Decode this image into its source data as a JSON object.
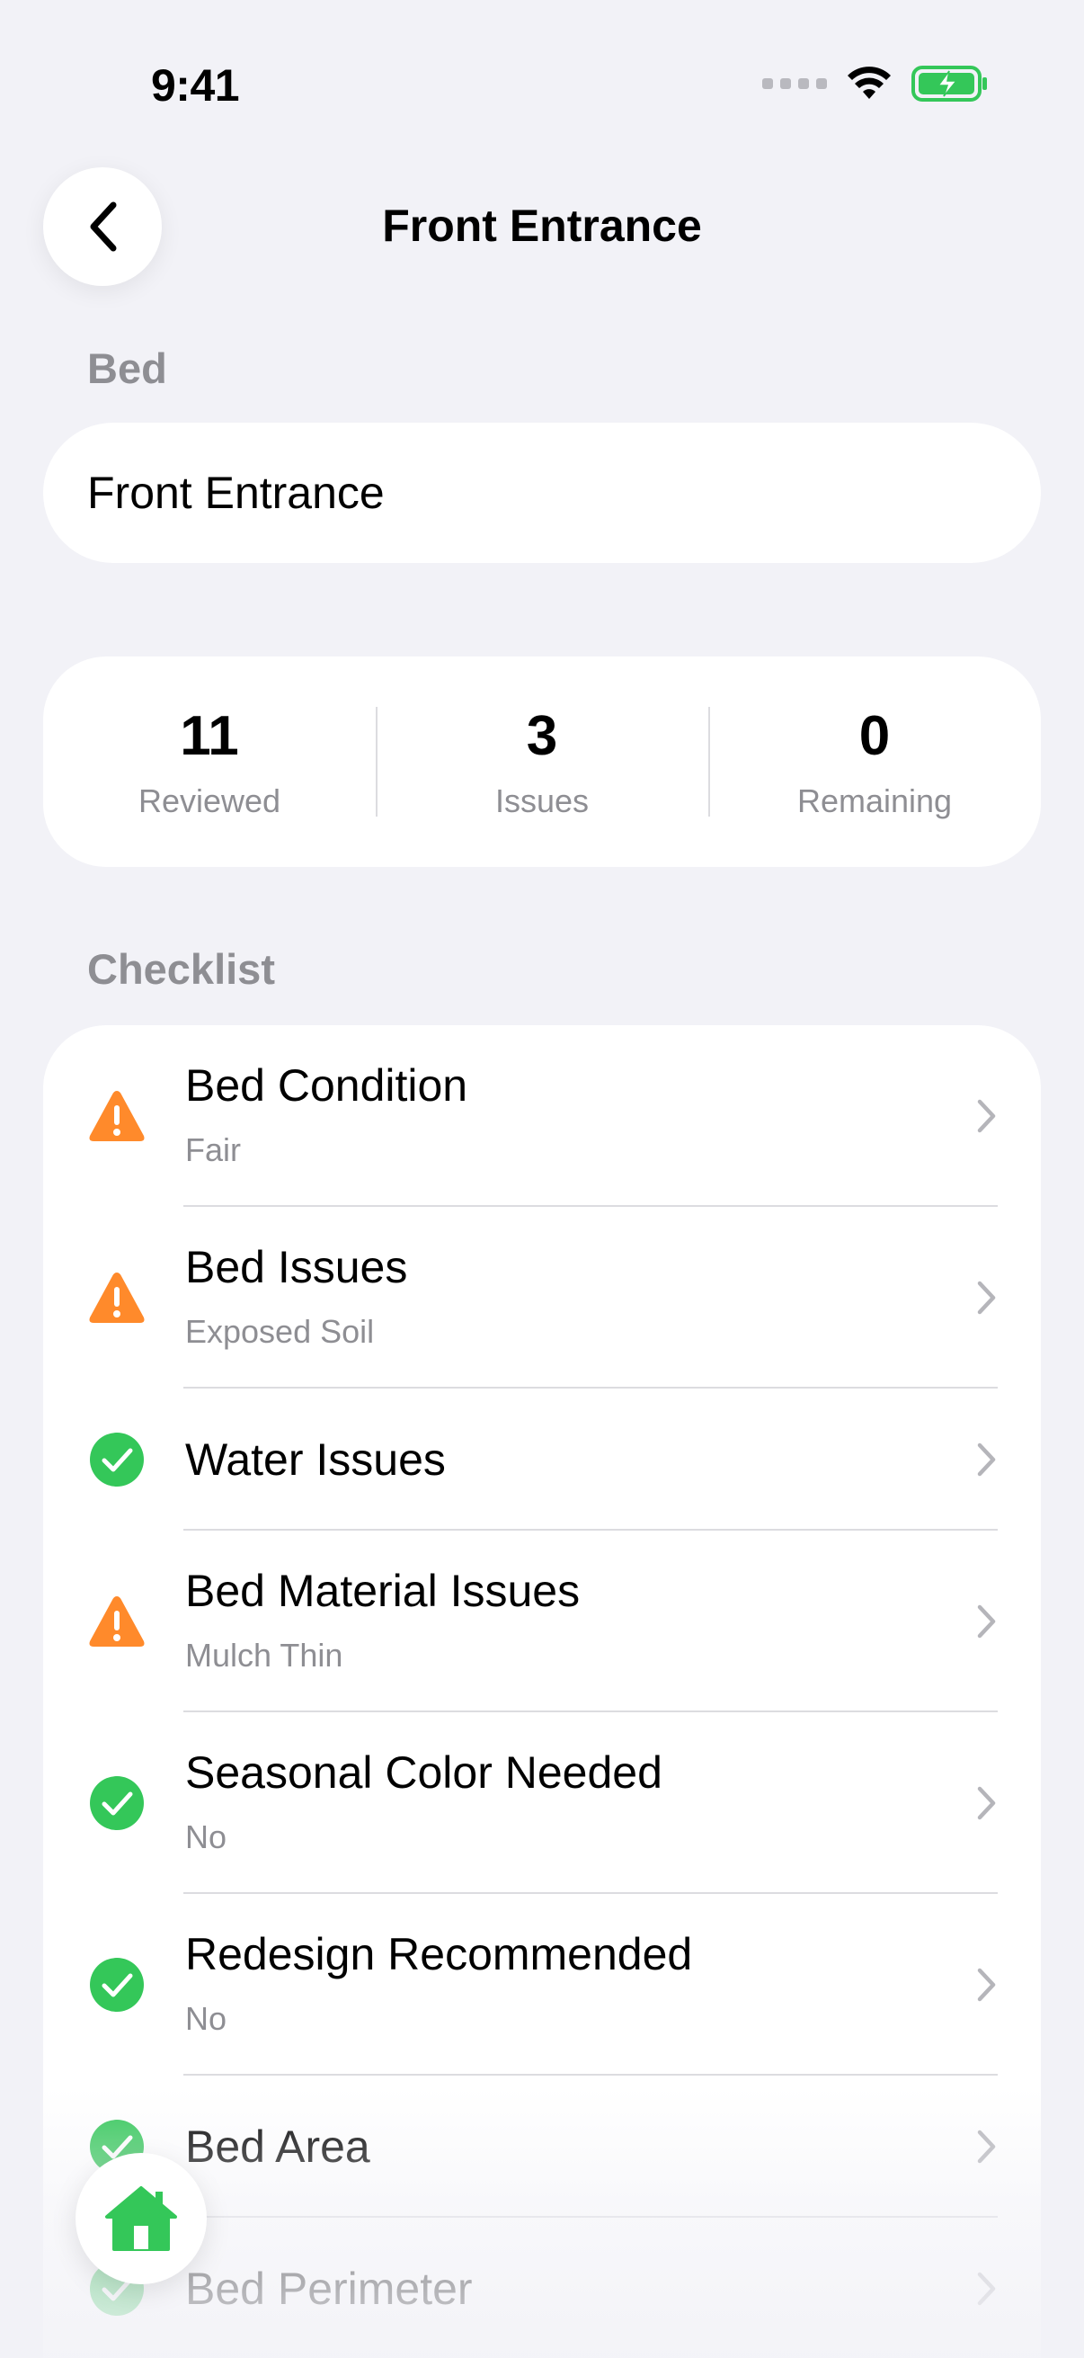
{
  "status_bar": {
    "time": "9:41"
  },
  "nav": {
    "title": "Front Entrance"
  },
  "bed": {
    "section_label": "Bed",
    "value": "Front Entrance"
  },
  "stats": [
    {
      "value": "11",
      "label": "Reviewed"
    },
    {
      "value": "3",
      "label": "Issues"
    },
    {
      "value": "0",
      "label": "Remaining"
    }
  ],
  "checklist": {
    "section_label": "Checklist",
    "items": [
      {
        "title": "Bed Condition",
        "subtitle": "Fair",
        "status": "warning"
      },
      {
        "title": "Bed Issues",
        "subtitle": "Exposed Soil",
        "status": "warning"
      },
      {
        "title": "Water Issues",
        "subtitle": "",
        "status": "ok"
      },
      {
        "title": "Bed Material Issues",
        "subtitle": "Mulch Thin",
        "status": "warning"
      },
      {
        "title": "Seasonal Color Needed",
        "subtitle": "No",
        "status": "ok"
      },
      {
        "title": "Redesign Recommended",
        "subtitle": "No",
        "status": "ok"
      },
      {
        "title": "Bed Area",
        "subtitle": "",
        "status": "ok"
      },
      {
        "title": "Bed Perimeter",
        "subtitle": "",
        "status": "ok"
      }
    ]
  },
  "colors": {
    "warning": "#FF8A2B",
    "ok": "#34C759",
    "background": "#F2F2F7",
    "secondary_text": "#8E8E93"
  },
  "icons": {
    "back": "chevron-left-icon",
    "home": "home-icon",
    "warning": "warning-triangle-icon",
    "ok": "checkmark-circle-icon",
    "row_chevron": "chevron-right-icon"
  }
}
